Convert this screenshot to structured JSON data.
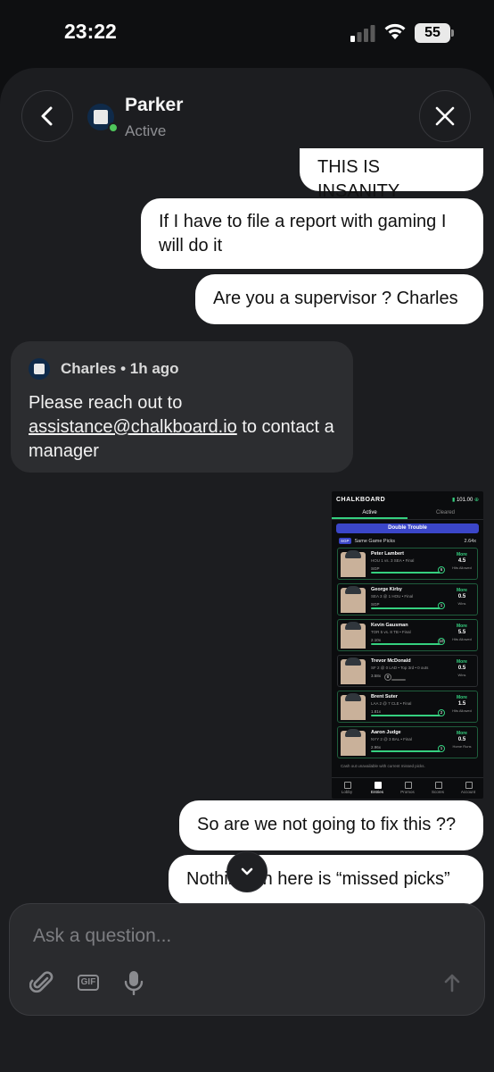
{
  "status_bar": {
    "time": "23:22",
    "battery": "55"
  },
  "header": {
    "name": "Parker",
    "status": "Active"
  },
  "messages": {
    "m1": "THIS IS INSANITY",
    "m2": "If I have to file a report with gaming I will do it",
    "m3": "Are you a supervisor ? Charles",
    "incoming": {
      "sender": "Charles • 1h ago",
      "text_before": "Please reach out to ",
      "link": "assistance@chalkboard.io",
      "text_after": " to contact a manager"
    },
    "m4": "So are we not going to fix this ??",
    "m5": "Nothing on here is “missed picks”"
  },
  "screenshot": {
    "brand": "CHALKBOARD",
    "balance": "101.00",
    "tabs": [
      "Active",
      "Cleared"
    ],
    "banner": "Double Trouble",
    "group_label": "Same Game Picks",
    "group_badge": "SGP",
    "group_mult": "2.64x",
    "picks": [
      {
        "name": "Peter Lambert",
        "game": "HOU 1 vs. 3 SEA • Final",
        "mult": "SGP",
        "count": "6",
        "dir": "More",
        "value": "4.5",
        "stat": "Hits Allowed"
      },
      {
        "name": "George Kirby",
        "game": "SEA 3 @ 1 HOU • Final",
        "mult": "SGP",
        "count": "1",
        "dir": "More",
        "value": "0.5",
        "stat": "Wins"
      },
      {
        "name": "Kevin Gausman",
        "game": "TOR 5 vs. 8 TB • Final",
        "mult": "2.10x",
        "count": "10",
        "dir": "More",
        "value": "5.5",
        "stat": "Hits Allowed"
      },
      {
        "name": "Trevor McDonald",
        "game": "SF 2 @ 0 LAD • Top 3rd • 0 outs",
        "mult": "3.58x",
        "count": "0",
        "dir": "More",
        "value": "0.5",
        "stat": "Wins"
      },
      {
        "name": "Brent Suter",
        "game": "LAA 2 @ 7 CLE • Final",
        "mult": "1.81x",
        "count": "2",
        "dir": "More",
        "value": "1.5",
        "stat": "Hits Allowed"
      },
      {
        "name": "Aaron Judge",
        "game": "NYY 2 @ 3 BAL • Final",
        "mult": "2.96x",
        "count": "1",
        "dir": "More",
        "value": "0.5",
        "stat": "Home Runs"
      }
    ],
    "cashout_note": "Cash out unavailable with current missed picks.",
    "nav": [
      "Lobby",
      "Entries",
      "Promos",
      "Scores",
      "Account"
    ]
  },
  "composer": {
    "placeholder": "Ask a question..."
  },
  "colors": {
    "background": "#0e0f11",
    "sheet": "#1c1d20",
    "incoming_bubble": "#2c2d30",
    "outgoing_bubble": "#ffffff",
    "online": "#4ec55b",
    "accent_green": "#35d07f"
  }
}
